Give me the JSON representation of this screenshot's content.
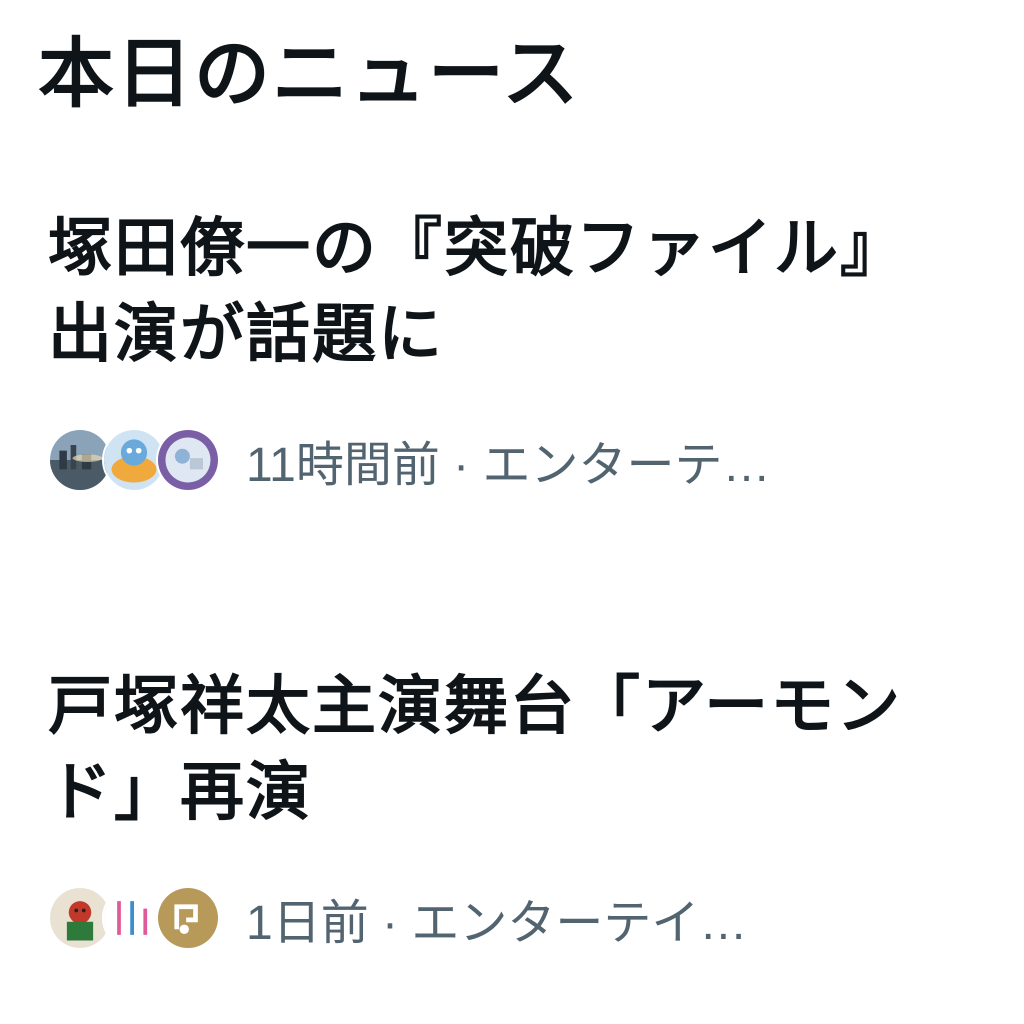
{
  "section": {
    "title": "本日のニュース"
  },
  "news": [
    {
      "headline": "塚田僚一の『突破ファイル』出演が話題に",
      "meta": "11時間前 · エンターテ…",
      "avatars": [
        "cityscape-avatar",
        "mascot-avatar",
        "person-avatar"
      ]
    },
    {
      "headline": "戸塚祥太主演舞台「アーモンド」再演",
      "meta": "1日前 · エンターテイ…",
      "avatars": [
        "character-avatar",
        "tbc-logo-avatar",
        "natalie-logo-avatar"
      ]
    }
  ]
}
